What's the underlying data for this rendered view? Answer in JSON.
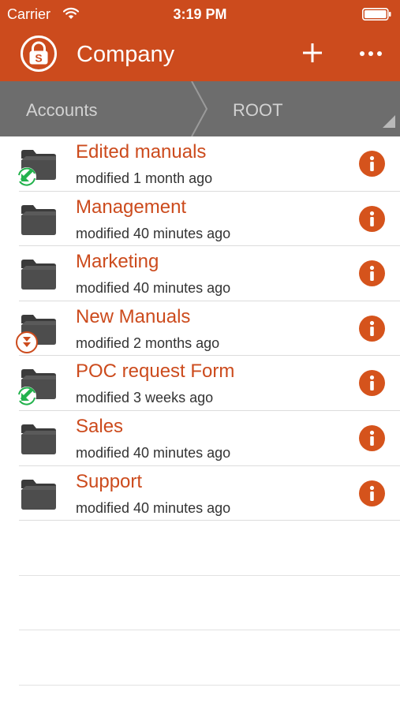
{
  "status_bar": {
    "carrier": "Carrier",
    "time": "3:19 PM"
  },
  "nav": {
    "title": "Company",
    "add_icon": "plus-icon",
    "more_icon": "more-icon",
    "logo_icon": "lock-logo-icon"
  },
  "breadcrumb": {
    "items": [
      "Accounts",
      "ROOT"
    ]
  },
  "colors": {
    "accent": "#cc4b1d",
    "breadcrumb_bg": "#6d6d6d",
    "sync_badge": "#22b24c"
  },
  "folders": [
    {
      "name": "Edited manuals",
      "modified": "modified 1 month ago",
      "badge": "sync-icon"
    },
    {
      "name": "Management",
      "modified": "modified 40 minutes ago",
      "badge": ""
    },
    {
      "name": "Marketing",
      "modified": "modified 40 minutes ago",
      "badge": ""
    },
    {
      "name": "New Manuals",
      "modified": "modified 2 months ago",
      "badge": "download-icon"
    },
    {
      "name": "POC request Form",
      "modified": "modified 3 weeks ago",
      "badge": "sync-icon"
    },
    {
      "name": "Sales",
      "modified": "modified 40 minutes ago",
      "badge": ""
    },
    {
      "name": "Support",
      "modified": "modified 40 minutes ago",
      "badge": ""
    }
  ]
}
